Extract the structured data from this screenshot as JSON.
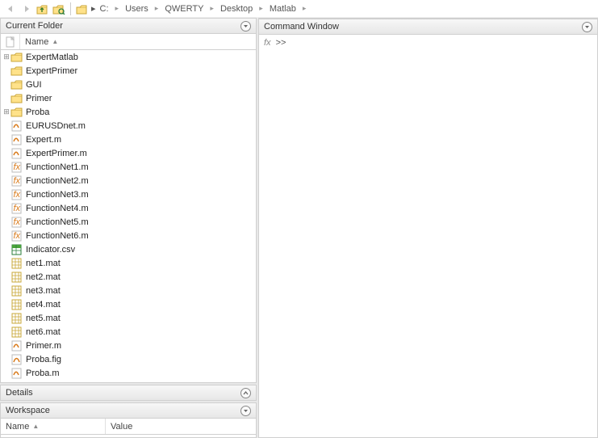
{
  "toolbar": {
    "breadcrumb": [
      "C:",
      "Users",
      "QWERTY",
      "Desktop",
      "Matlab"
    ]
  },
  "panels": {
    "currentFolder": {
      "title": "Current Folder",
      "nameHeader": "Name",
      "folders": [
        {
          "name": "ExpertMatlab",
          "expandable": true
        },
        {
          "name": "ExpertPrimer",
          "expandable": false
        },
        {
          "name": "GUI",
          "expandable": false
        },
        {
          "name": "Primer",
          "expandable": false
        },
        {
          "name": "Proba",
          "expandable": true
        }
      ],
      "files": [
        {
          "name": "EURUSDnet.m",
          "type": "m"
        },
        {
          "name": "Expert.m",
          "type": "m"
        },
        {
          "name": "ExpertPrimer.m",
          "type": "m"
        },
        {
          "name": "FunctionNet1.m",
          "type": "fx"
        },
        {
          "name": "FunctionNet2.m",
          "type": "fx"
        },
        {
          "name": "FunctionNet3.m",
          "type": "fx"
        },
        {
          "name": "FunctionNet4.m",
          "type": "fx"
        },
        {
          "name": "FunctionNet5.m",
          "type": "fx"
        },
        {
          "name": "FunctionNet6.m",
          "type": "fx"
        },
        {
          "name": "Indicator.csv",
          "type": "csv"
        },
        {
          "name": "net1.mat",
          "type": "mat"
        },
        {
          "name": "net2.mat",
          "type": "mat"
        },
        {
          "name": "net3.mat",
          "type": "mat"
        },
        {
          "name": "net4.mat",
          "type": "mat"
        },
        {
          "name": "net5.mat",
          "type": "mat"
        },
        {
          "name": "net6.mat",
          "type": "mat"
        },
        {
          "name": "Primer.m",
          "type": "m"
        },
        {
          "name": "Proba.fig",
          "type": "fig"
        },
        {
          "name": "Proba.m",
          "type": "m"
        }
      ]
    },
    "details": {
      "title": "Details"
    },
    "workspace": {
      "title": "Workspace",
      "cols": {
        "name": "Name",
        "value": "Value"
      }
    },
    "commandWindow": {
      "title": "Command Window",
      "fx": "fx",
      "prompt": ">>"
    }
  }
}
